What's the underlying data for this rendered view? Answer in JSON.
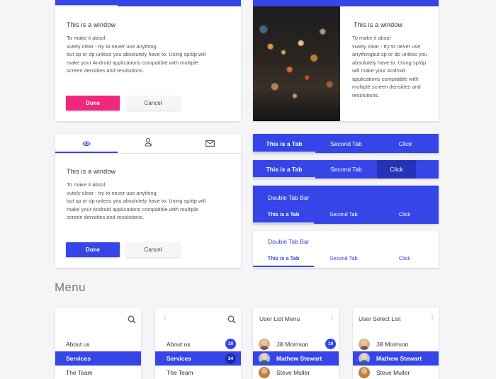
{
  "window_card_1": {
    "title": "This is a window",
    "body": "To make it absol\nvutely clear - try to never use anything\nbut sp or dp unless you absolutely have to. Using sp/dp will\nmake your Android applications compatible with multiple\nscreen densities and resolutions.",
    "done_label": "Done",
    "cancel_label": "Cancel"
  },
  "image_card": {
    "title": "This is a window",
    "body": "To make it absol\nvutely clear - try to never use anythingbut sp or dp unless you absolutely have to. Using sp/dp will make your Android applications compatible with multiple screen densities and resolutions."
  },
  "window_card_2": {
    "tabs": [
      "eye-icon",
      "add-user-icon",
      "mail-icon"
    ],
    "title": "This is a window",
    "body": "To make it absol\nvutely clear - try to never use anything\nbut sp or dp unless you absolutely have to. Using sp/dp will\nmake your Android applications compatible with multiple\nscreen densities and resolutions.",
    "done_label": "Done",
    "cancel_label": "Cancel"
  },
  "tabbar_1": {
    "tabs": [
      "This is a Tab",
      "Second Tab",
      "Click"
    ]
  },
  "tabbar_2": {
    "tabs": [
      "This is a Tab",
      "Second Tab",
      "Click"
    ]
  },
  "double_tabbar_blue": {
    "title": "Double Tab Bar",
    "tabs": [
      "This is a Tab",
      "Second Tab",
      "Click"
    ]
  },
  "double_tabbar_white": {
    "title": "Double Tab Bar",
    "tabs": [
      "This is a Tab",
      "Second Tab",
      "Click"
    ]
  },
  "menu_section": {
    "title": "Menu"
  },
  "menu_1": {
    "items": [
      "About us",
      "Services",
      "The Team"
    ]
  },
  "menu_2": {
    "items": [
      "About us",
      "Services",
      "The Team"
    ],
    "badges": [
      "19",
      "34"
    ]
  },
  "menu_3": {
    "title": "User List Menu",
    "users": [
      "Jill Morrison",
      "Mathew Stewart",
      "Steve Muller"
    ],
    "badges": [
      "19"
    ]
  },
  "menu_4": {
    "title": "User Select List",
    "users": [
      "Jill Morrison",
      "Mathew Stewart",
      "Steve Muller"
    ]
  },
  "colors": {
    "accent": "#3545e8",
    "pink": "#f0277e",
    "tab_active_bg": "#2433b8"
  }
}
